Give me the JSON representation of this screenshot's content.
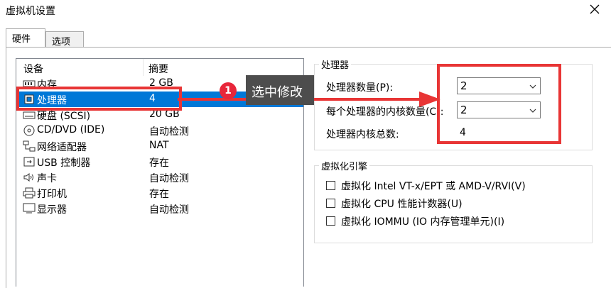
{
  "window": {
    "title": "虚拟机设置"
  },
  "tabs": [
    {
      "label": "硬件",
      "active": true
    },
    {
      "label": "选项",
      "active": false
    }
  ],
  "device_list": {
    "headers": {
      "device": "设备",
      "summary": "摘要"
    },
    "rows": [
      {
        "icon": "memory-icon",
        "name": "内存",
        "summary": "2 GB",
        "selected": false
      },
      {
        "icon": "processor-icon",
        "name": "处理器",
        "summary": "4",
        "selected": true
      },
      {
        "icon": "hard-disk-icon",
        "name": "硬盘 (SCSI)",
        "summary": "20 GB",
        "selected": false
      },
      {
        "icon": "cd-dvd-icon",
        "name": "CD/DVD (IDE)",
        "summary": "自动检测",
        "selected": false
      },
      {
        "icon": "network-adapter-icon",
        "name": "网络适配器",
        "summary": "NAT",
        "selected": false
      },
      {
        "icon": "usb-icon",
        "name": "USB 控制器",
        "summary": "存在",
        "selected": false
      },
      {
        "icon": "sound-card-icon",
        "name": "声卡",
        "summary": "自动检测",
        "selected": false
      },
      {
        "icon": "printer-icon",
        "name": "打印机",
        "summary": "存在",
        "selected": false
      },
      {
        "icon": "display-icon",
        "name": "显示器",
        "summary": "自动检测",
        "selected": false
      }
    ]
  },
  "processor": {
    "group_title": "处理器",
    "count_label": "处理器数量(P):",
    "count_value": "2",
    "cores_label": "每个处理器的内核数量(C):",
    "cores_value": "2",
    "total_label": "处理器内核总数:",
    "total_value": "4"
  },
  "virtualization": {
    "group_title": "虚拟化引擎",
    "options": [
      {
        "label": "虚拟化 Intel VT-x/EPT 或 AMD-V/RVI(V)",
        "checked": false
      },
      {
        "label": "虚拟化 CPU 性能计数器(U)",
        "checked": false
      },
      {
        "label": "虚拟化 IOMMU (IO 内存管理单元)(I)",
        "checked": false
      }
    ]
  },
  "annotation": {
    "step": "1",
    "callout": "选中修改",
    "color": "#e83535"
  },
  "colors": {
    "selection": "#0078d7",
    "callout_bg": "#4d4d4d"
  }
}
